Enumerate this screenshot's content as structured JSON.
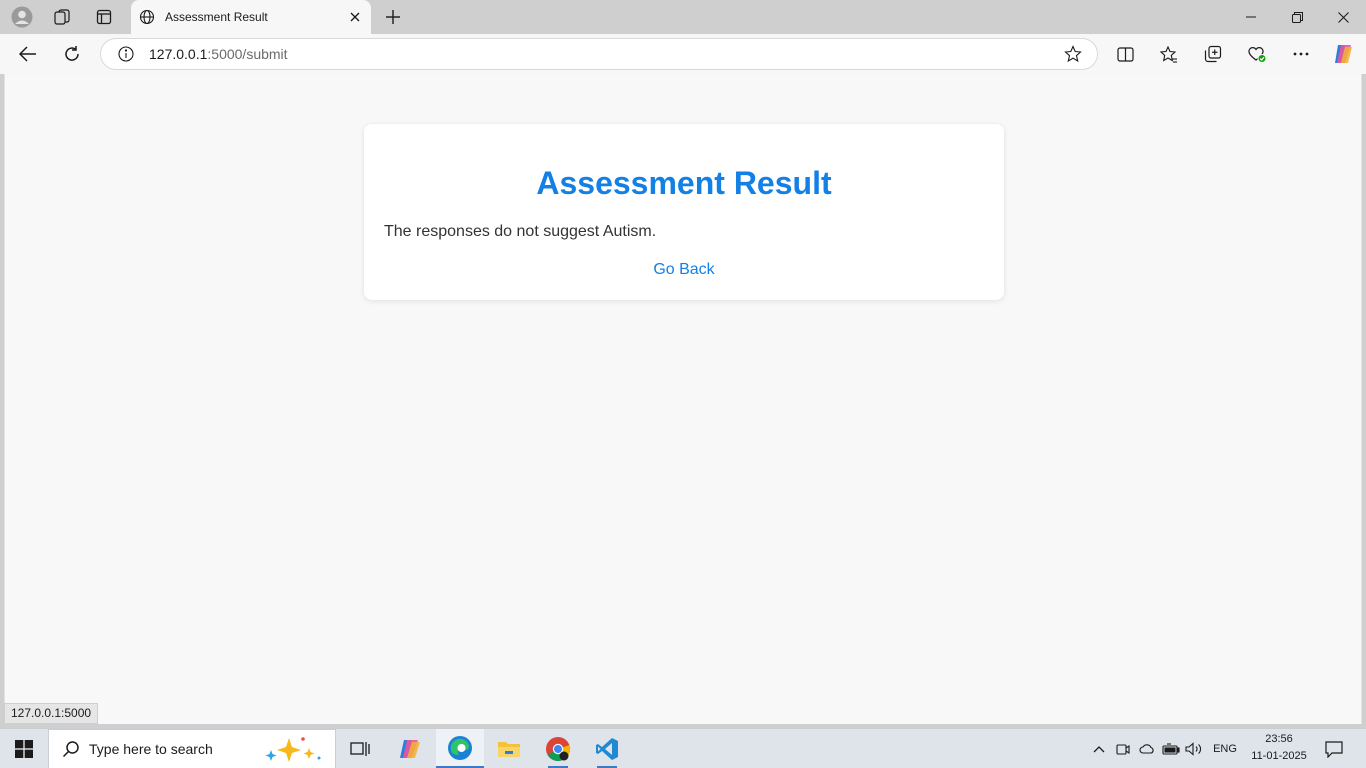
{
  "browser": {
    "tab_title": "Assessment Result",
    "url_host": "127.0.0.1",
    "url_rest": ":5000/submit",
    "status_url": "127.0.0.1:5000"
  },
  "page": {
    "heading": "Assessment Result",
    "message": "The responses do not suggest Autism.",
    "back_link": "Go Back",
    "accent_color": "#1380e5"
  },
  "taskbar": {
    "search_placeholder": "Type here to search",
    "language": "ENG",
    "time": "23:56",
    "date": "11-01-2025"
  },
  "icons": [
    "profile-icon",
    "workspaces-icon",
    "vertical-tabs-icon",
    "globe-icon",
    "close-icon",
    "plus-icon",
    "minimize-icon",
    "restore-icon",
    "back-icon",
    "refresh-icon",
    "info-icon",
    "star-icon",
    "split-screen-icon",
    "favorites-icon",
    "collections-icon",
    "browser-essentials-icon",
    "more-icon",
    "copilot-icon",
    "windows-start-icon",
    "search-icon",
    "task-view-icon",
    "edge-icon",
    "file-explorer-icon",
    "chrome-icon",
    "vscode-icon",
    "notification-icon"
  ]
}
